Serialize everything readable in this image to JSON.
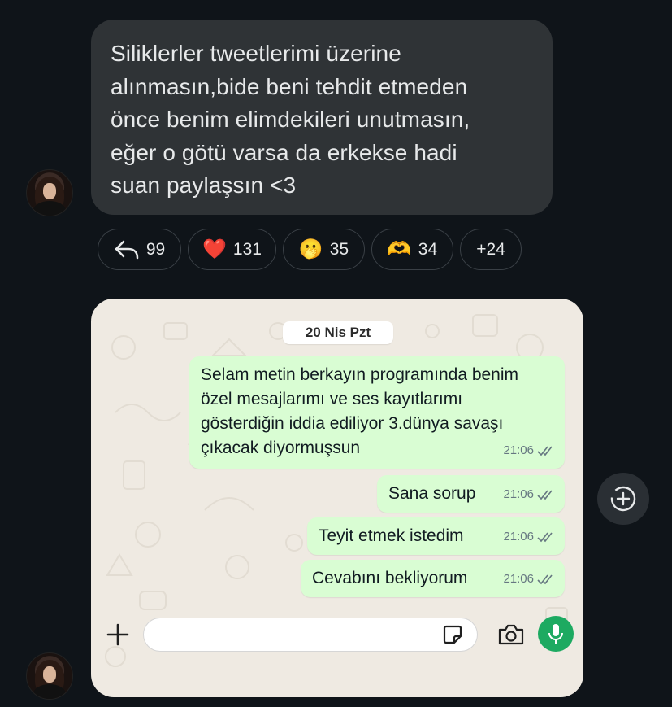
{
  "message": {
    "text": "Siliklerler tweetlerimi üzerine\nalınmasın,bide beni tehdit etmeden\nönce benim elimdekileri unutmasın,\neğer o götü varsa da erkekse hadi\nsuan paylaşsın <3"
  },
  "reactions": {
    "reply": {
      "icon": "reply-icon",
      "count": "99"
    },
    "heart": {
      "emoji": "❤️",
      "count": "131"
    },
    "face": {
      "emoji": "🫢",
      "count": "35"
    },
    "hands": {
      "emoji": "🫶",
      "count": "34"
    },
    "more": {
      "label": "+24"
    }
  },
  "whatsapp": {
    "date_label": "20 Nis Pzt",
    "messages": [
      {
        "text": "Selam metin berkayın programında benim\nözel mesajlarımı ve ses kayıtlarımı\ngösterdiğin iddia ediliyor 3.dünya savaşı\nçıkacak diyormuşsun",
        "time": "21:06"
      },
      {
        "text": "Sana sorup",
        "time": "21:06"
      },
      {
        "text": "Teyit etmek istedim",
        "time": "21:06"
      },
      {
        "text": "Cevabını bekliyorum",
        "time": "21:06"
      }
    ],
    "input": {
      "value": "",
      "placeholder": ""
    },
    "colors": {
      "outgoing_bubble": "#d9fdd3",
      "background": "#efeae2",
      "mic_button": "#1daa61"
    }
  },
  "colors": {
    "page_background": "#0f1419",
    "dm_bubble": "#2f3336",
    "text": "#e7e9ea"
  },
  "icons": [
    "reply-icon",
    "plus-icon",
    "sticker-icon",
    "camera-icon",
    "mic-icon",
    "add-reaction-icon",
    "double-check-icon"
  ]
}
